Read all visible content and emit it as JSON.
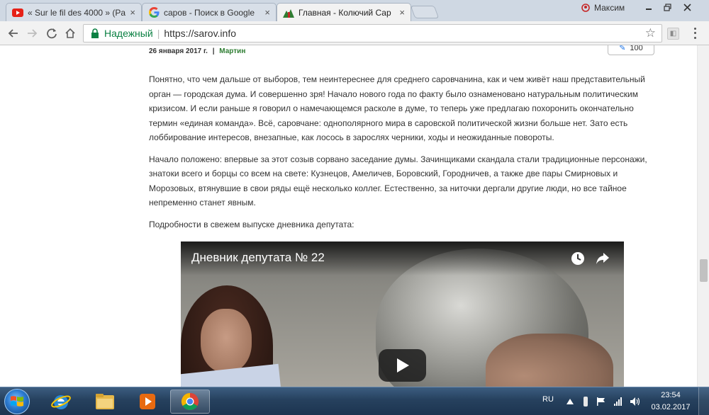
{
  "browser": {
    "tabs": [
      {
        "title": "« Sur le fil des 4000 » (Pa",
        "favicon": "youtube-icon",
        "active": false
      },
      {
        "title": "саров - Поиск в Google",
        "favicon": "google-icon",
        "active": false
      },
      {
        "title": "Главная - Колючий Сар",
        "favicon": "site-icon",
        "active": true
      }
    ],
    "profile_name": "Максим",
    "security_label": "Надежный",
    "url": "https://sarov.info"
  },
  "page": {
    "meta_date": "26 января 2017 г.",
    "meta_separator": "|",
    "meta_author": "Мартин",
    "counter": "100",
    "paragraphs": [
      "Понятно, что чем дальше от выборов, тем неинтереснее для среднего саровчанина, как и чем живёт наш представительный орган — городская дума. И совершенно зря! Начало нового года по факту было ознаменовано натуральным политическим кризисом. И если раньше я говорил о намечающемся расколе в думе, то теперь уже предлагаю похоронить окончательно термин «единая команда». Всё, саровчане: однополярного мира в саровской политической жизни больше нет. Зато есть лоббирование интересов, внезапные, как лосось в зарослях черники, ходы и неожиданные повороты.",
      "Начало положено: впервые за этот созыв сорвано заседание думы. Зачинщиками скандала стали традиционные персонажи, знатоки всего и борцы со всем на свете: Кузнецов, Амеличев, Боровский, Городничев, а также две пары Смирновых и Морозовых, втянувшие в свои ряды ещё несколько коллег. Естественно, за ниточки дергали другие люди, но все тайное непременно станет явным.",
      "Подробности в свежем выпуске дневника депутата:"
    ],
    "video_title": "Дневник депутата № 22"
  },
  "taskbar": {
    "lang": "RU",
    "time": "23:54",
    "date": "03.02.2017"
  },
  "colors": {
    "secure_green": "#0b8043",
    "author_green": "#2e7d32",
    "taskbar": "#26415e"
  }
}
